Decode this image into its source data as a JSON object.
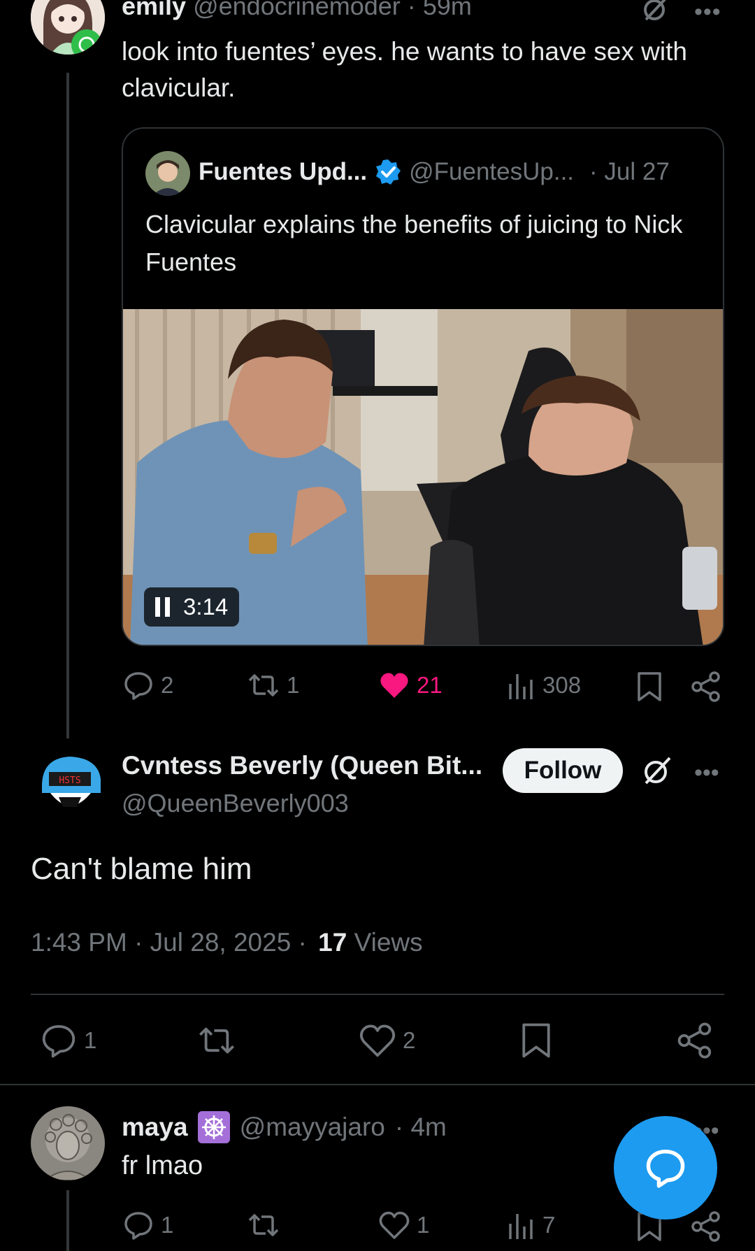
{
  "post1": {
    "display_name": "emily",
    "handle": "@endocrinemoder",
    "time_sep": "·",
    "time": "59m",
    "text": "look into fuentes’ eyes. he wants to have sex with clavicular.",
    "quoted": {
      "display_name": "Fuentes Upd...",
      "handle": "@FuentesUp...",
      "date": "· Jul 27",
      "text": "Clavicular explains the benefits of juicing to Nick Fuentes",
      "video_duration": "3:14"
    },
    "stats": {
      "replies": "2",
      "reposts": "1",
      "likes": "21",
      "views": "308"
    }
  },
  "post2": {
    "display_name": "Cvntess Beverly (Queen Bit...",
    "handle": "@QueenBeverly003",
    "follow_label": "Follow",
    "text": "Can't blame him",
    "timestamp": "1:43 PM · Jul 28, 2025 ·",
    "views_count": "17",
    "views_label": "Views",
    "stats": {
      "replies": "1",
      "likes": "2"
    }
  },
  "post3": {
    "display_name": "maya",
    "handle": "@mayyajaro",
    "time": "· 4m",
    "text": "fr lmao",
    "stats": {
      "replies": "1",
      "likes": "1",
      "views": "7"
    }
  },
  "colors": {
    "accent": "#1d9bf0",
    "like_active": "#f91880",
    "verified": "#1d9bf0",
    "maya_badge": "#7856ff"
  }
}
